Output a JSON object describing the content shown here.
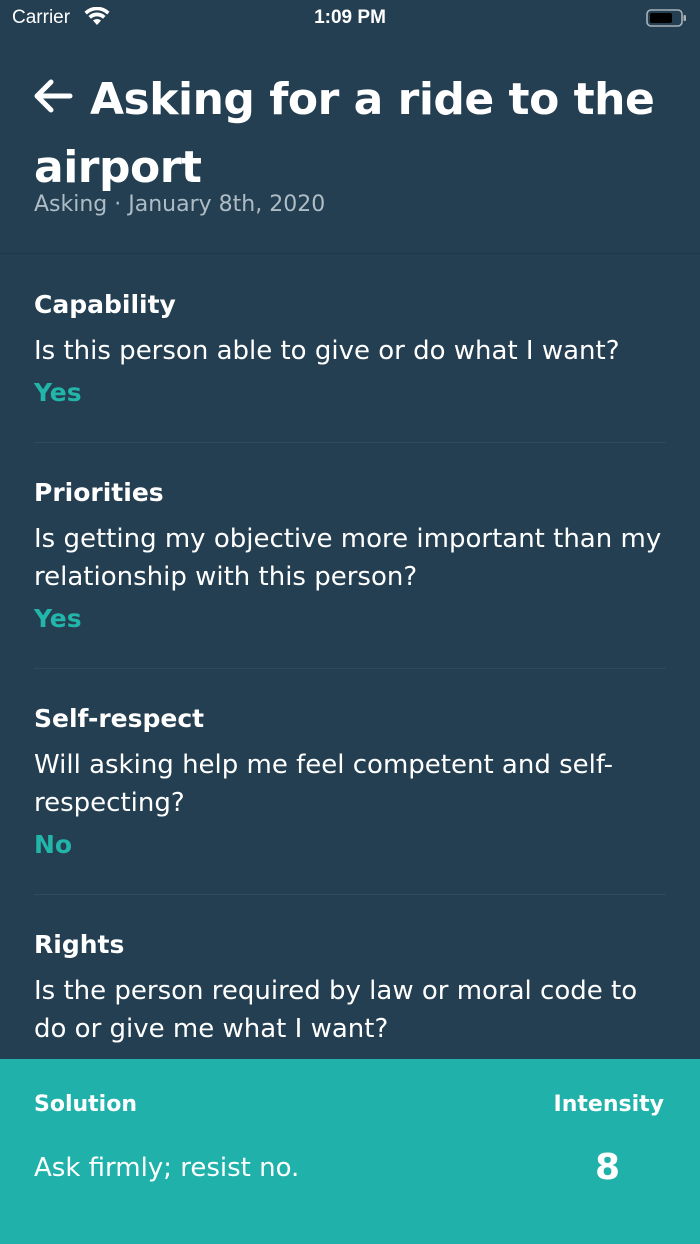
{
  "status_bar": {
    "carrier": "Carrier",
    "time": "1:09 PM",
    "icons": [
      "wifi-icon",
      "battery-icon"
    ]
  },
  "header": {
    "title": "Asking for a ride to the airport",
    "subtitle": "Asking · January 8th, 2020",
    "back_icon": "arrow-left-icon"
  },
  "questions": [
    {
      "title": "Capability",
      "question": "Is this person able to give or do what I want?",
      "answer": "Yes"
    },
    {
      "title": "Priorities",
      "question": "Is getting my objective more important than my relationship with this person?",
      "answer": "Yes"
    },
    {
      "title": "Self-respect",
      "question": "Will asking help me feel competent and self-respecting?",
      "answer": "No"
    },
    {
      "title": "Rights",
      "question": "Is the person required by law or moral code to do or give me what I want?",
      "answer": ""
    }
  ],
  "solution": {
    "label": "Solution",
    "text": "Ask firmly; resist no.",
    "intensity_label": "Intensity",
    "intensity_value": "8"
  },
  "colors": {
    "background": "#243f51",
    "accent": "#20b2aa",
    "answer": "#22b5a9"
  }
}
